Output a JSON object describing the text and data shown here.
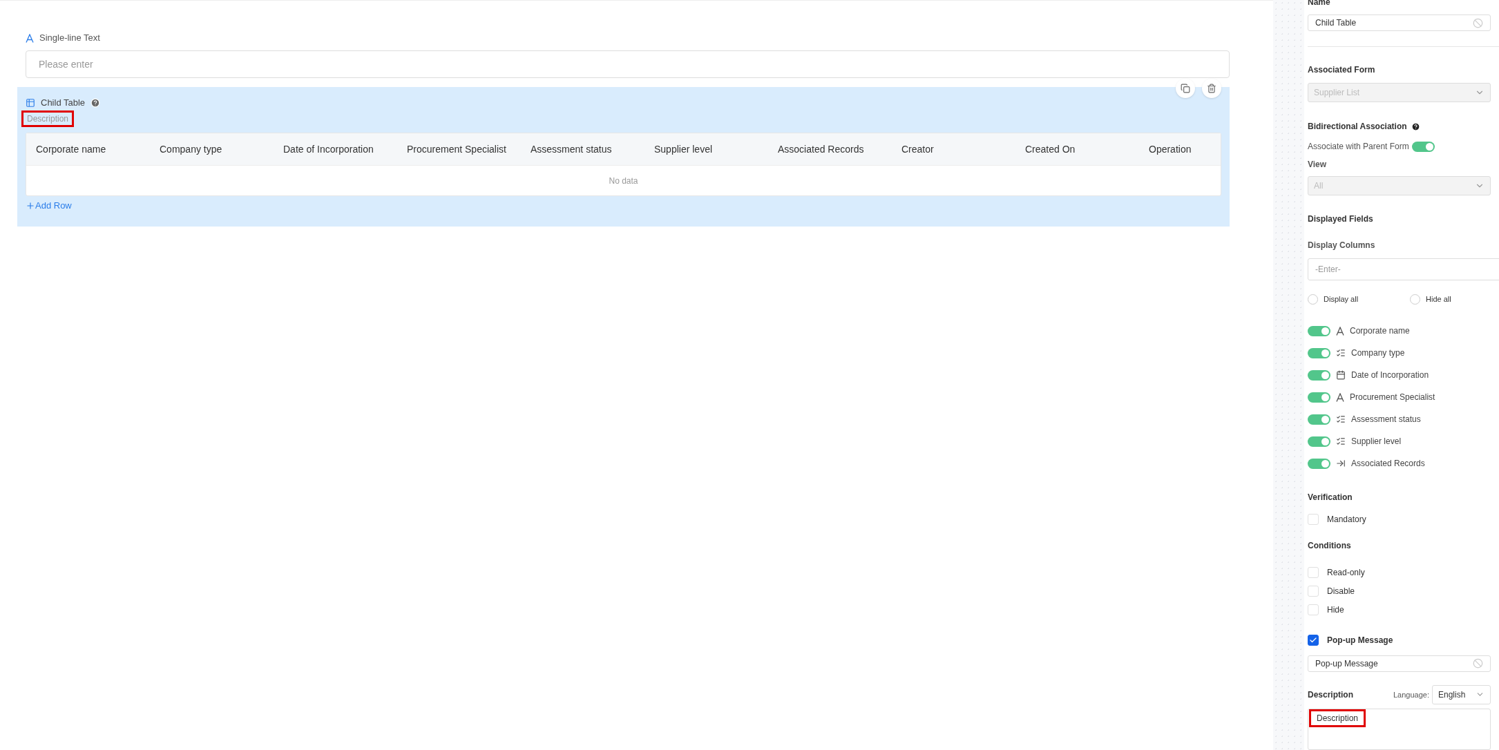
{
  "canvas": {
    "text_field": {
      "label": "Single-line Text",
      "placeholder": "Please enter"
    },
    "child_table": {
      "title": "Child Table",
      "description": "Description",
      "description_highlighted": true,
      "columns": [
        "Corporate name",
        "Company type",
        "Date of Incorporation",
        "Procurement Specialist",
        "Assessment status",
        "Supplier level",
        "Associated Records",
        "Creator",
        "Created On",
        "Operation"
      ],
      "empty_text": "No data",
      "add_row": "Add Row"
    }
  },
  "panel": {
    "name": {
      "label": "Name",
      "value": "Child Table"
    },
    "associated_form": {
      "label": "Associated Form",
      "value": "Supplier List",
      "disabled": true
    },
    "bidirectional": {
      "label": "Bidirectional Association",
      "toggle_label": "Associate with Parent Form",
      "on": true
    },
    "view": {
      "label": "View",
      "value": "All",
      "disabled": true
    },
    "displayed_fields": "Displayed Fields",
    "display_columns": {
      "label": "Display Columns",
      "placeholder": "-Enter-"
    },
    "radios": [
      {
        "label": "Display all",
        "selected": false
      },
      {
        "label": "Hide all",
        "selected": false
      }
    ],
    "fields": [
      {
        "label": "Corporate name",
        "kind": "text",
        "on": true
      },
      {
        "label": "Company type",
        "kind": "choice",
        "on": true
      },
      {
        "label": "Date of Incorporation",
        "kind": "date",
        "on": true
      },
      {
        "label": "Procurement Specialist",
        "kind": "text",
        "on": true
      },
      {
        "label": "Assessment status",
        "kind": "choice",
        "on": true
      },
      {
        "label": "Supplier level",
        "kind": "choice",
        "on": true
      },
      {
        "label": "Associated Records",
        "kind": "relation",
        "on": true
      }
    ],
    "verification": {
      "title": "Verification",
      "options": [
        {
          "label": "Mandatory",
          "checked": false
        }
      ]
    },
    "conditions": {
      "title": "Conditions",
      "options": [
        {
          "label": "Read-only",
          "checked": false
        },
        {
          "label": "Disable",
          "checked": false
        },
        {
          "label": "Hide",
          "checked": false
        }
      ]
    },
    "popup": {
      "label": "Pop-up Message",
      "checked": true,
      "value": "Pop-up Message"
    },
    "description": {
      "label": "Description",
      "language_label": "Language:",
      "language": "English",
      "value": "Description",
      "highlighted": true
    }
  }
}
